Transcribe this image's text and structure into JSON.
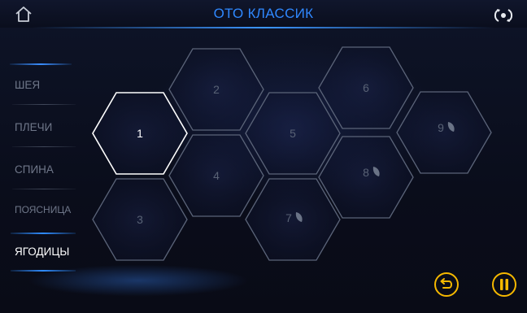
{
  "header": {
    "title": "ОТО КЛАССИК",
    "home_icon": "home-icon",
    "rotate_icon": "rotate-icon"
  },
  "sidebar": {
    "items": [
      {
        "label": "ШЕЯ",
        "active": false
      },
      {
        "label": "ПЛЕЧИ",
        "active": false
      },
      {
        "label": "СПИНА",
        "active": false
      },
      {
        "label": "ПОЯСНИЦА",
        "active": false
      },
      {
        "label": "ЯГОДИЦЫ",
        "active": true
      }
    ]
  },
  "hexes": [
    {
      "label": "1",
      "active": true
    },
    {
      "label": "2",
      "active": false
    },
    {
      "label": "3",
      "active": false
    },
    {
      "label": "4",
      "active": false
    },
    {
      "label": "5",
      "active": false
    },
    {
      "label": "6",
      "active": false
    },
    {
      "label": "7",
      "active": false,
      "icon": "leaf-icon"
    },
    {
      "label": "8",
      "active": false,
      "icon": "leaf-icon"
    },
    {
      "label": "9",
      "active": false,
      "icon": "leaf-icon"
    }
  ],
  "controls": {
    "back_icon": "return-icon",
    "pause_icon": "pause-icon",
    "accent": "#f5b800"
  }
}
